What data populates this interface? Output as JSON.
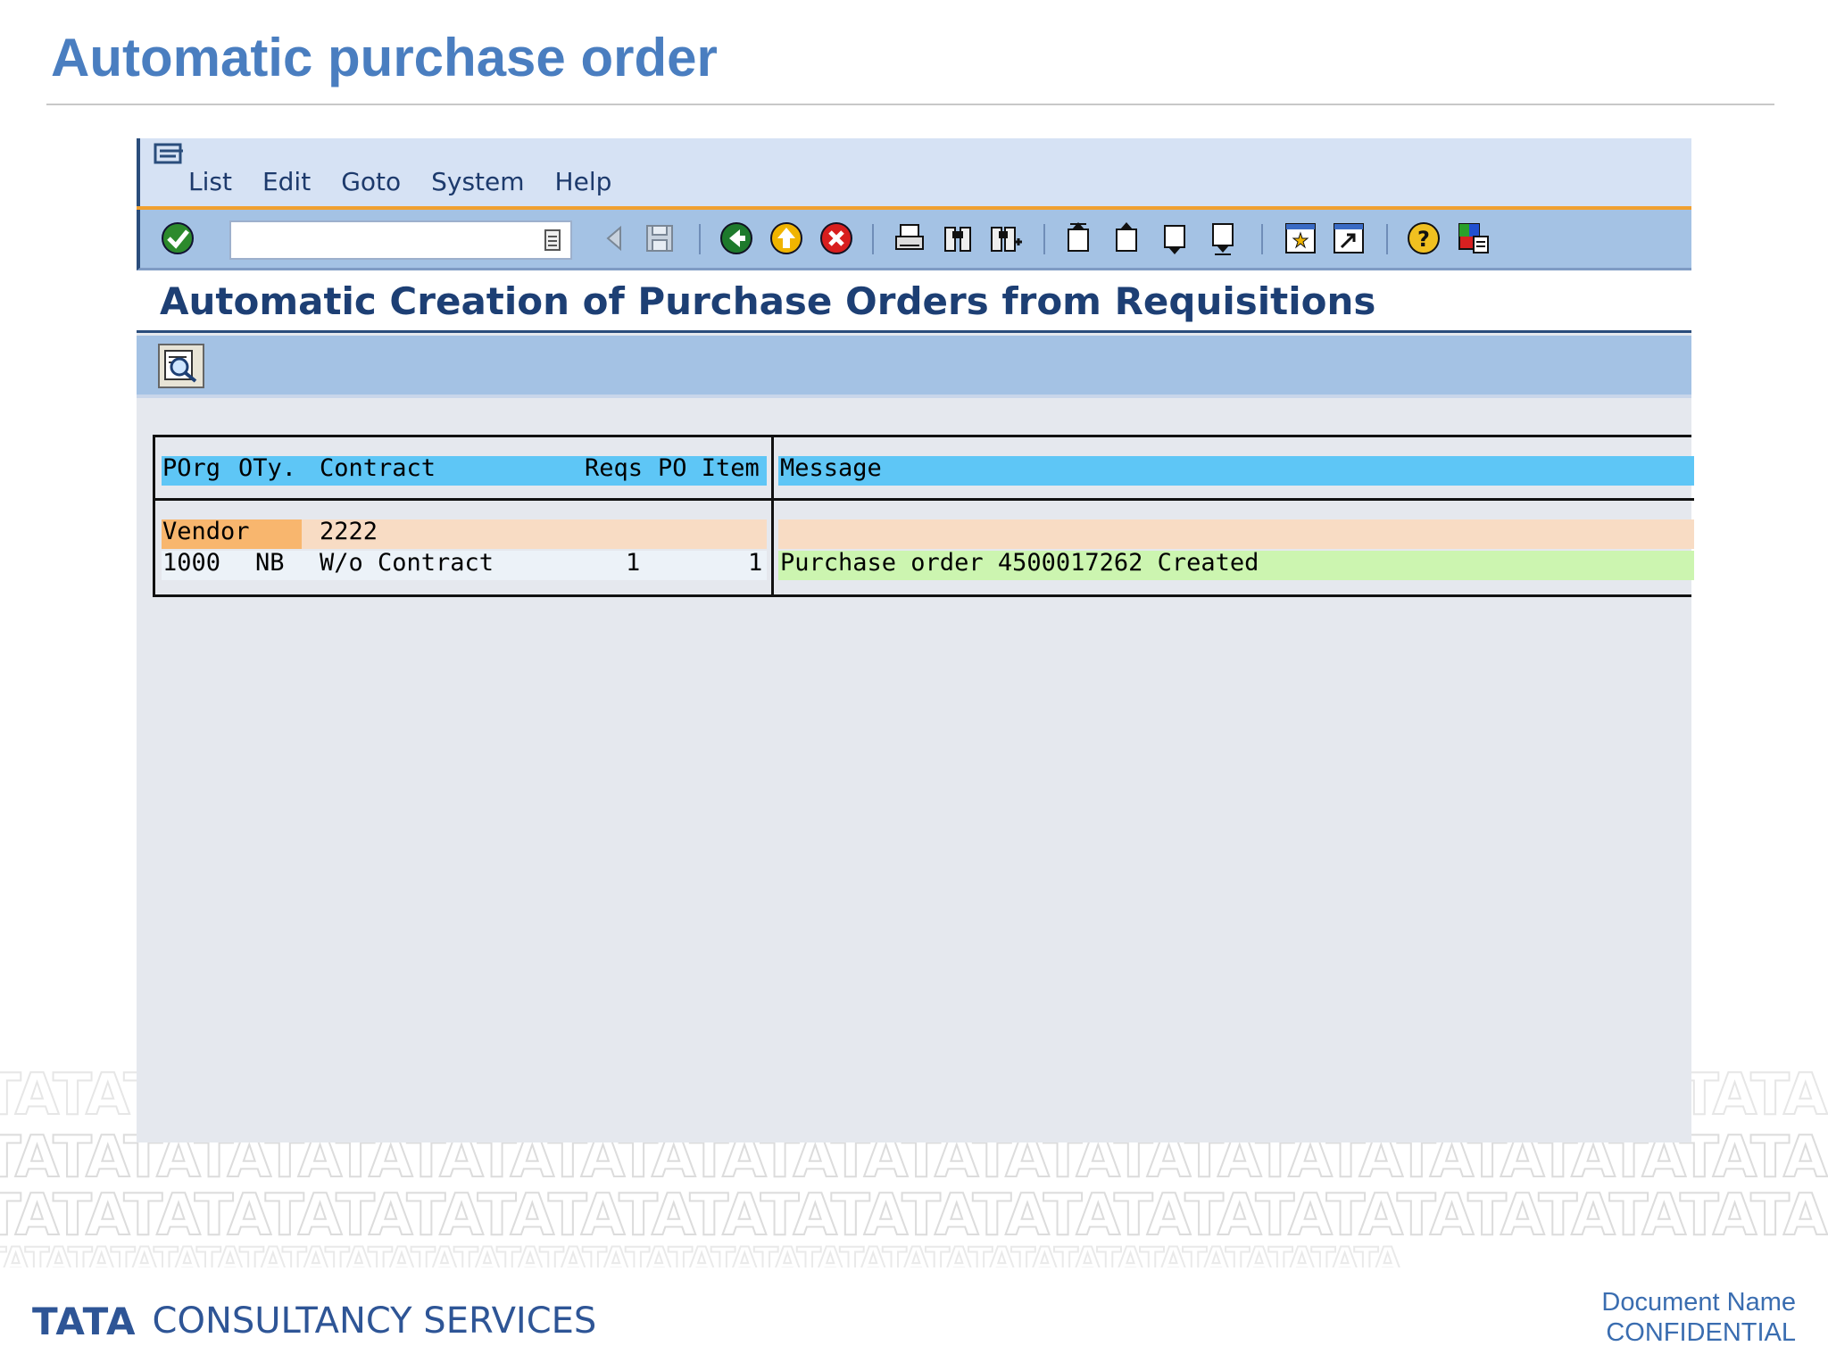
{
  "slide": {
    "title": "Automatic purchase order"
  },
  "sap": {
    "menu": [
      {
        "label": "List"
      },
      {
        "label": "Edit"
      },
      {
        "label": "Goto"
      },
      {
        "label": "System"
      },
      {
        "label": "Help"
      }
    ],
    "command_field": {
      "value": ""
    },
    "toolbar_icons": [
      "enter-icon",
      "back-arrow-icon",
      "save-icon",
      "back-icon",
      "exit-icon",
      "cancel-icon",
      "print-icon",
      "find-icon",
      "find-next-icon",
      "first-page-icon",
      "previous-page-icon",
      "next-page-icon",
      "last-page-icon",
      "create-session-icon",
      "shortcut-icon",
      "help-icon",
      "layout-menu-icon"
    ],
    "screen_title": "Automatic Creation of Purchase Orders from Requisitions",
    "app_toolbar_icon": "display-document-icon",
    "list": {
      "header": {
        "porg": "POrg",
        "oty": "OTy.",
        "contract": "Contract",
        "reqs": "Reqs",
        "po_item": "PO Item",
        "message": "Message"
      },
      "vendor_row": {
        "label": "Vendor",
        "value": "2222"
      },
      "rows": [
        {
          "porg": "1000",
          "oty": "NB",
          "contract": "W/o Contract",
          "reqs": "1",
          "po_item": "1",
          "message": "Purchase order 4500017262 Created"
        }
      ]
    },
    "colors": {
      "header_row": "#5ec6f6",
      "vendor_label": "#f8b66e",
      "vendor_value": "#f8dcc4",
      "success_message": "#ccf5b0"
    }
  },
  "footer": {
    "logo_word": "TATA",
    "company": "CONSULTANCY SERVICES",
    "document_name": "Document Name",
    "confidential": "CONFIDENTIAL"
  }
}
